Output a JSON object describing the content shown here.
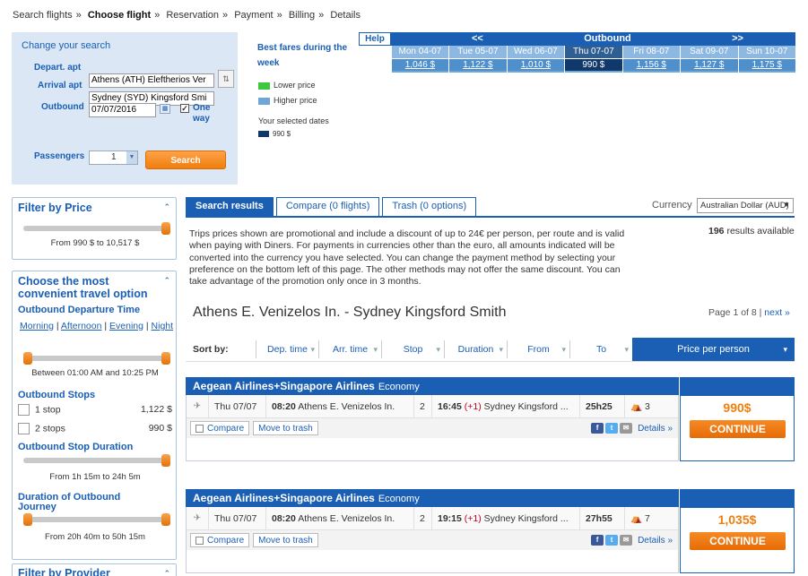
{
  "breadcrumb": [
    "Search flights",
    "Choose flight",
    "Reservation",
    "Payment",
    "Billing",
    "Details"
  ],
  "search": {
    "title": "Change your search",
    "depart_label": "Depart. apt",
    "arrival_label": "Arrival apt",
    "outbound_label": "Outbound",
    "depart_value": "Athens (ATH) Eleftherios Ver",
    "arrival_value": "Sydney (SYD) Kingsford Smi",
    "outbound_date": "07/07/2016",
    "one_way_label": "One way",
    "passengers_label": "Passengers",
    "passengers_value": "1",
    "search_button": "Search"
  },
  "fares_legend": {
    "title": "Best fares during the week",
    "lower": "Lower price",
    "higher": "Higher price",
    "your_dates": "Your selected dates",
    "selected_price": "990 $",
    "lower_color": "#3ec83e",
    "higher_color": "#6fa6d8",
    "selected_color": "#11386b"
  },
  "calendar": {
    "help": "Help",
    "prev": "<<",
    "title": "Outbound",
    "next": ">>",
    "days": [
      {
        "day": "Mon 04-07",
        "price": "1,046 $"
      },
      {
        "day": "Tue 05-07",
        "price": "1,122 $"
      },
      {
        "day": "Wed 06-07",
        "price": "1,010 $"
      },
      {
        "day": "Thu 07-07",
        "price": "990 $"
      },
      {
        "day": "Fri 08-07",
        "price": "1,156 $"
      },
      {
        "day": "Sat 09-07",
        "price": "1,127 $"
      },
      {
        "day": "Sun 10-07",
        "price": "1,175 $"
      }
    ]
  },
  "filters": {
    "price_title": "Filter by Price",
    "price_range": "From 990 $ to 10,517 $",
    "convenient_title": "Choose the most convenient travel option",
    "departure_time_label": "Outbound Departure Time",
    "time_options": [
      "Morning",
      "Afternoon",
      "Evening",
      "Night"
    ],
    "time_range": "Between 01:00 AM and 10:25 PM",
    "stops_label": "Outbound Stops",
    "stops": [
      {
        "label": "1 stop",
        "price": "1,122 $"
      },
      {
        "label": "2 stops",
        "price": "990 $"
      }
    ],
    "duration_label": "Outbound Stop Duration",
    "duration_range": "From 1h 15m to 24h 5m",
    "journey_label": "Duration of Outbound Journey",
    "journey_range": "From 20h 40m to 50h 15m",
    "provider_title": "Filter by Provider"
  },
  "tabs": {
    "results": "Search results",
    "compare": "Compare (0 flights)",
    "trash": "Trash (0 options)"
  },
  "currency": {
    "label": "Currency",
    "value": "Australian Dollar (AUD)"
  },
  "promo_text": "Trips prices shown are promotional and include a discount of up to 24€ per person, per route and is valid when paying with Diners. For payments in currencies other than the euro, all amounts indicated will be converted into the currency you have selected. You can change the payment method by selecting your preference on the bottom left of this page. The other methods may not offer the same discount. You can take advantage of the promotion only once in 3 months.",
  "results_count": "196",
  "results_available": "results available",
  "route_title": "Athens E. Venizelos In. - Sydney Kingsford Smith",
  "pager": {
    "text": "Page 1 of 8",
    "next": "next »"
  },
  "sort": {
    "label": "Sort by:",
    "items": [
      "Dep. time",
      "Arr. time",
      "Stop",
      "Duration",
      "From",
      "To"
    ],
    "price": "Price per person"
  },
  "results": [
    {
      "airline": "Aegean Airlines+Singapore Airlines",
      "cabin": "Economy",
      "date": "Thu 07/07",
      "dep_time": "08:20",
      "dep_airport": "Athens E. Venizelos In.",
      "stops": "2",
      "arr_time": "16:45",
      "day_offset": "(+1)",
      "arr_airport": "Sydney Kingsford ...",
      "duration": "25h25",
      "seats": "3",
      "price": "990$",
      "compare": "Compare",
      "trash": "Move to trash",
      "details": "Details",
      "continue": "CONTINUE"
    },
    {
      "airline": "Aegean Airlines+Singapore Airlines",
      "cabin": "Economy",
      "date": "Thu 07/07",
      "dep_time": "08:20",
      "dep_airport": "Athens E. Venizelos In.",
      "stops": "2",
      "arr_time": "19:15",
      "day_offset": "(+1)",
      "arr_airport": "Sydney Kingsford ...",
      "duration": "27h55",
      "seats": "7",
      "price": "1,035$",
      "compare": "Compare",
      "trash": "Move to trash",
      "details": "Details",
      "continue": "CONTINUE"
    }
  ]
}
